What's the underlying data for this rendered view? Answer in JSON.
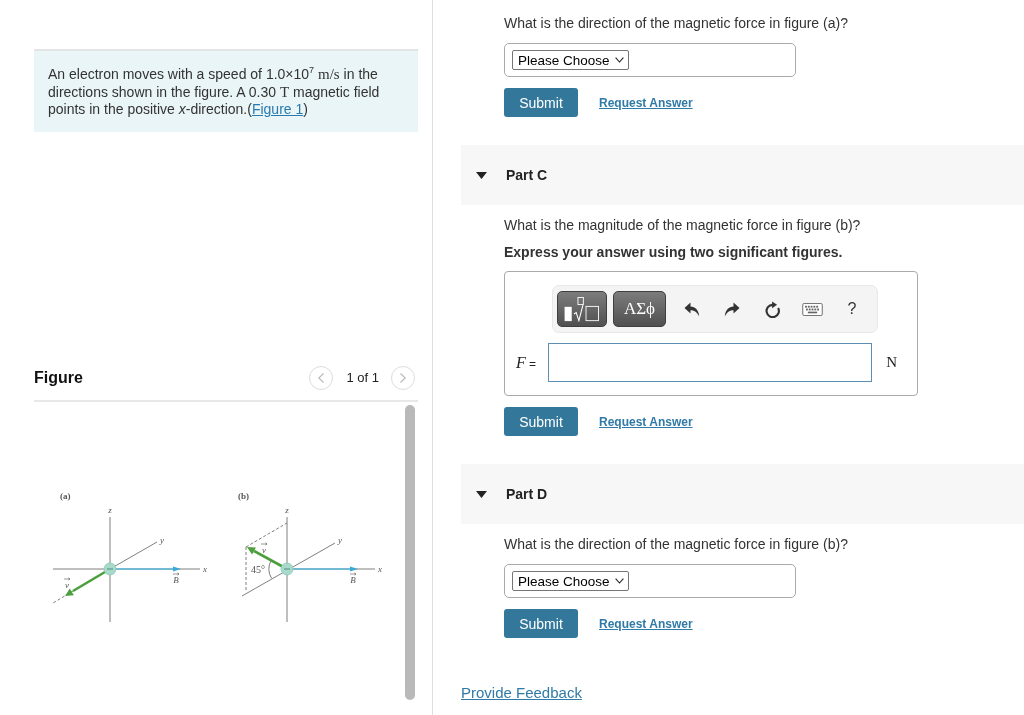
{
  "problem": {
    "segments": [
      {
        "kind": "text",
        "text": "An electron moves with a speed of 1.0×10$^{7}$ "
      },
      {
        "kind": "math",
        "text": "m/s"
      },
      {
        "kind": "text",
        "text": " in the directions shown in the figure. A 0.30 "
      },
      {
        "kind": "math",
        "text": "T"
      },
      {
        "kind": "text",
        "text": " magnetic field points in the positive *x*-direction.("
      },
      {
        "kind": "link",
        "text": "Figure 1"
      },
      {
        "kind": "text",
        "text": ")"
      }
    ]
  },
  "figure": {
    "title": "Figure",
    "pager": "1 of 1",
    "nav": {
      "prev": {
        "disabled": true
      },
      "next": {
        "disabled": true
      }
    },
    "panels": [
      {
        "kind": "along-y",
        "label": "(a)",
        "axes": [
          "z",
          "y",
          "x"
        ],
        "velocity": "v",
        "field": "B"
      },
      {
        "kind": "tilted",
        "label": "(b)",
        "axes": [
          "z",
          "y",
          "x"
        ],
        "velocity": "v",
        "field": "B",
        "angle": "45°"
      }
    ]
  },
  "parts": [
    {
      "kind": "choice",
      "question": "What is the direction of the magnetic force in figure (a)?",
      "select": "Please Choose",
      "submit": "Submit",
      "request": "Request Answer"
    },
    {
      "title": "Part C",
      "expanded": true,
      "kind": "numeric",
      "question": "What is the magnitude of the magnetic force in figure (b)?",
      "instruction": "Express your answer using two significant figures.",
      "toolbar": [
        {
          "kind": "templates"
        },
        {
          "kind": "symbols",
          "label": "ΑΣϕ"
        },
        {
          "kind": "undo"
        },
        {
          "kind": "redo"
        },
        {
          "kind": "reset"
        },
        {
          "kind": "keyboard"
        },
        {
          "kind": "help",
          "label": "?"
        }
      ],
      "label": "*F* =",
      "unit": "N",
      "submit": "Submit",
      "request": "Request Answer"
    },
    {
      "title": "Part D",
      "expanded": true,
      "kind": "choice",
      "question": "What is the direction of the magnetic force in figure (b)?",
      "select": "Please Choose",
      "submit": "Submit",
      "request": "Request Answer"
    }
  ],
  "feedback": "Provide Feedback"
}
